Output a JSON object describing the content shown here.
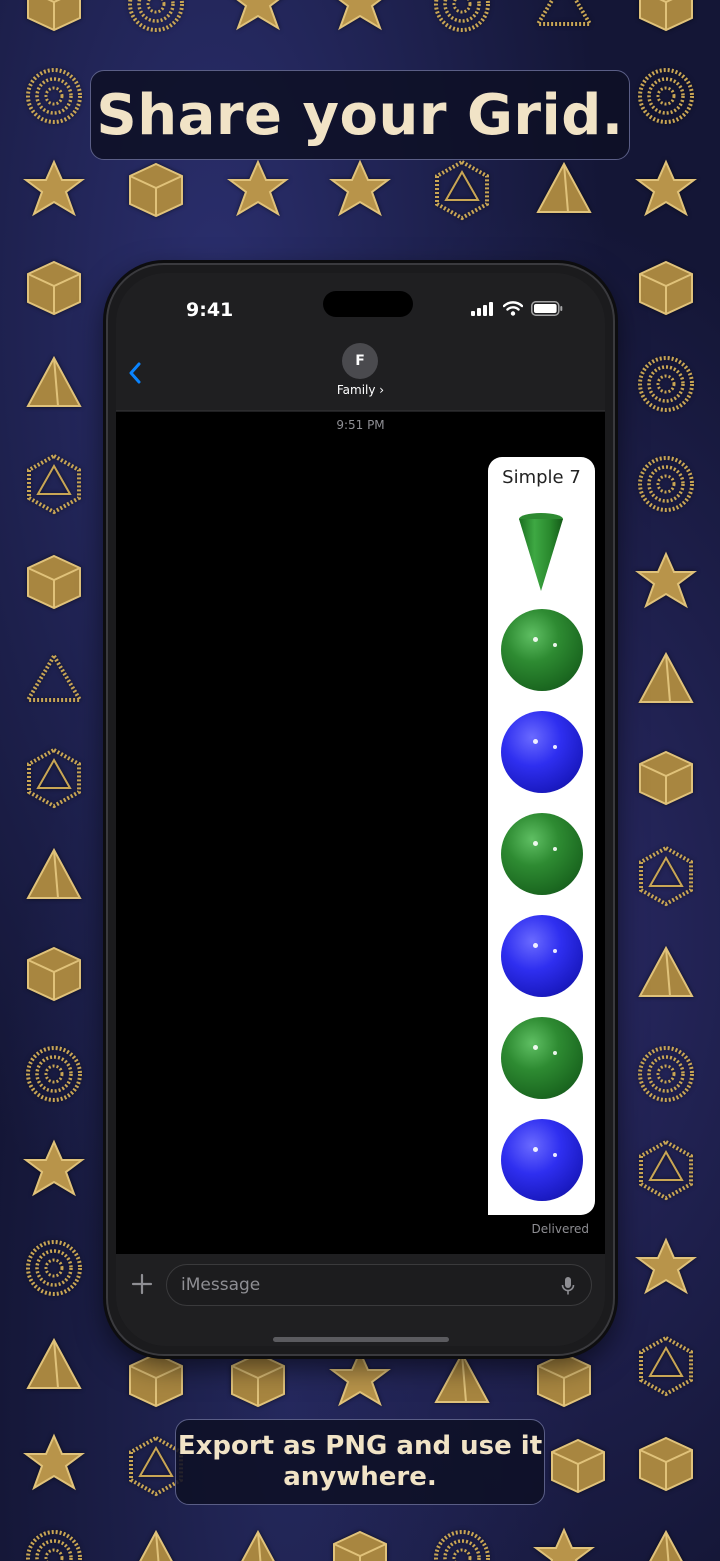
{
  "captions": {
    "top": "Share your Grid.",
    "bottom": "Export as PNG and use it anywhere."
  },
  "status_bar": {
    "time": "9:41",
    "icons": [
      "cellular-signal-icon",
      "wifi-icon",
      "battery-icon"
    ]
  },
  "conversation": {
    "avatar_initial": "F",
    "contact_name": "Family ›",
    "timestamp": "9:51 PM",
    "delivered_label": "Delivered"
  },
  "grid_message": {
    "title": "Simple 7",
    "items": [
      {
        "shape": "cone",
        "color": "green"
      },
      {
        "shape": "sphere",
        "color": "green"
      },
      {
        "shape": "sphere",
        "color": "blue"
      },
      {
        "shape": "sphere",
        "color": "green"
      },
      {
        "shape": "sphere",
        "color": "blue"
      },
      {
        "shape": "sphere",
        "color": "green"
      },
      {
        "shape": "sphere",
        "color": "blue"
      }
    ]
  },
  "composer": {
    "placeholder": "iMessage"
  },
  "colors": {
    "gold": "#c9a655",
    "caption_text": "#f1e3c6",
    "ios_blue": "#0a84ff",
    "sphere_green": "#2e8b32",
    "sphere_blue": "#2f2ff0"
  },
  "background_symbols": [
    "star-tetrahedron-icon",
    "spiral-icon",
    "cube-icon",
    "pyramid-icon",
    "dodecahedron-icon",
    "hexagram-icon"
  ]
}
